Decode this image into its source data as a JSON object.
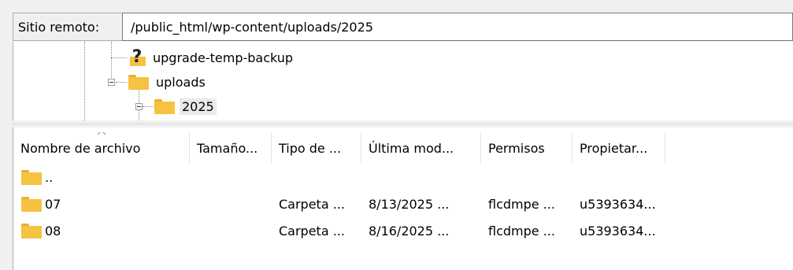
{
  "remote_path": {
    "label": "Sitio remoto:",
    "value": "/public_html/wp-content/uploads/2025"
  },
  "tree": {
    "items": [
      {
        "label": "upgrade-temp-backup",
        "icon": "question-folder-icon",
        "expanded": false
      },
      {
        "label": "uploads",
        "icon": "folder-icon",
        "expanded": true
      },
      {
        "label": "2025",
        "icon": "folder-icon",
        "expanded": true,
        "selected": true
      }
    ]
  },
  "file_list": {
    "sort_column": "Nombre de archivo",
    "columns": [
      "Nombre de archivo",
      "Tamaño...",
      "Tipo de ...",
      "Última mod...",
      "Permisos",
      "Propietar..."
    ],
    "rows": [
      {
        "name": "..",
        "size": "",
        "type": "",
        "modified": "",
        "permissions": "",
        "owner": ""
      },
      {
        "name": "07",
        "size": "",
        "type": "Carpeta ...",
        "modified": "8/13/2025 ...",
        "permissions": "flcdmpe ...",
        "owner": "u5393634..."
      },
      {
        "name": "08",
        "size": "",
        "type": "Carpeta ...",
        "modified": "8/16/2025 ...",
        "permissions": "flcdmpe ...",
        "owner": "u5393634..."
      }
    ]
  },
  "colors": {
    "folder": "#f5c242",
    "folder_tab": "#e8b030",
    "selection": "#eaeaea",
    "pane_bg": "#ffffff",
    "chrome_bg": "#f0f0f0"
  }
}
